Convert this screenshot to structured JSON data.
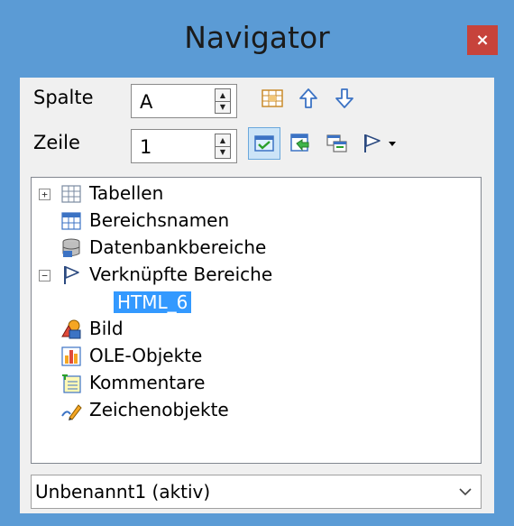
{
  "window": {
    "title": "Navigator",
    "close_glyph": "×"
  },
  "controls": {
    "column_label": "Spalte",
    "column_value": "A",
    "row_label": "Zeile",
    "row_value": "1"
  },
  "toolbar": {
    "icons": [
      "data-range-icon",
      "arrow-up-icon",
      "arrow-down-icon",
      "contents-toggle-icon",
      "scenarios-icon",
      "drag-mode-icon",
      "flag-icon",
      "dropdown-arrow-icon"
    ]
  },
  "tree": {
    "items": [
      {
        "label": "Tabellen",
        "icon": "table-icon",
        "expander": "+"
      },
      {
        "label": "Bereichsnamen",
        "icon": "range-names-icon"
      },
      {
        "label": "Datenbankbereiche",
        "icon": "database-icon"
      },
      {
        "label": "Verknüpfte Bereiche",
        "icon": "flag-icon",
        "expander": "−"
      },
      {
        "label": "HTML_6",
        "selected": true
      },
      {
        "label": "Bild",
        "icon": "image-icon"
      },
      {
        "label": "OLE-Objekte",
        "icon": "chart-icon"
      },
      {
        "label": "Kommentare",
        "icon": "comment-icon"
      },
      {
        "label": "Zeichenobjekte",
        "icon": "drawing-icon"
      }
    ]
  },
  "document_select": {
    "value": "Unbenannt1 (aktiv)"
  },
  "colors": {
    "titlebar": "#5b9bd5",
    "close": "#c7433b",
    "selection": "#3399ff",
    "panel": "#f0f0f0"
  }
}
